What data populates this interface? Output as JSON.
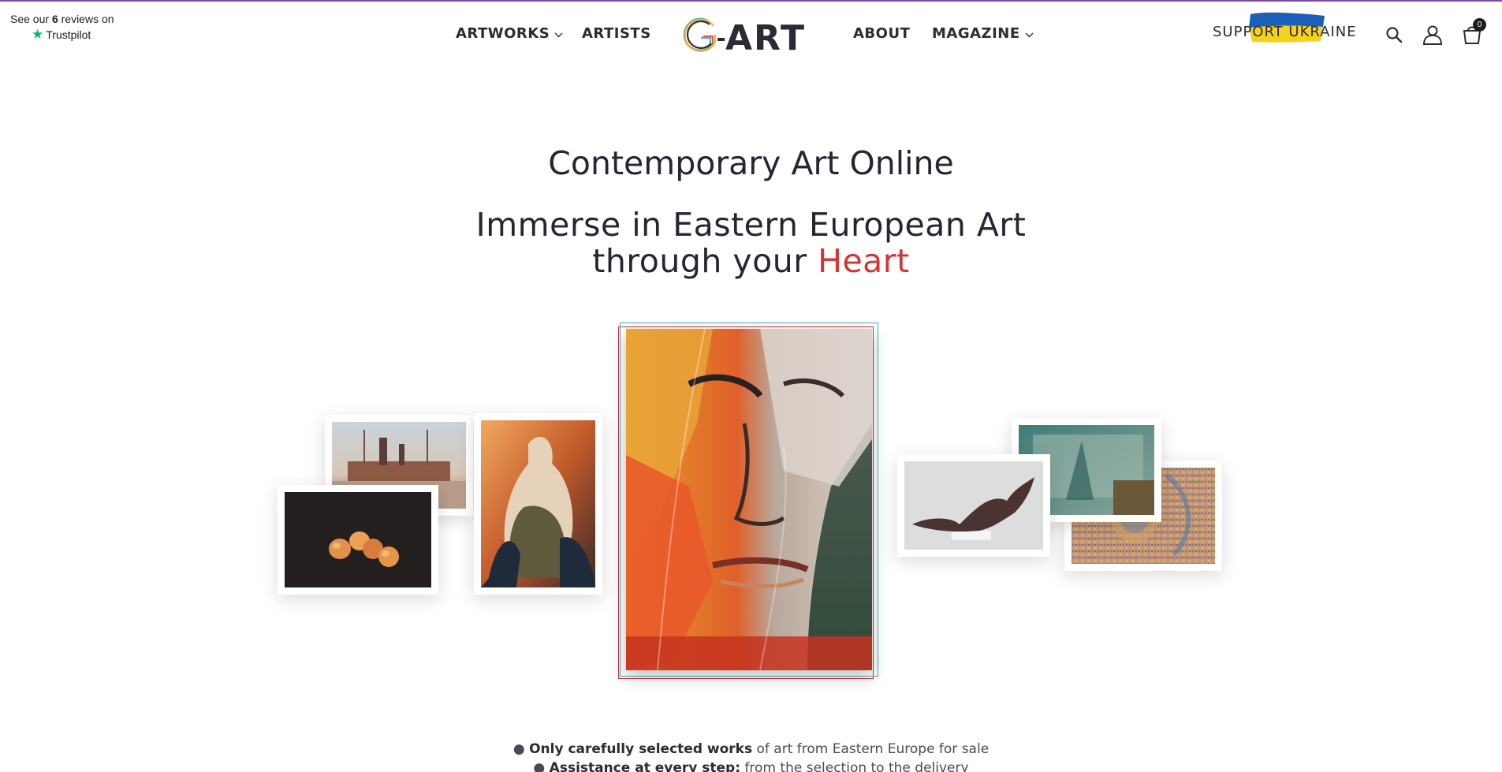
{
  "header": {
    "trustpilot": {
      "prefix": "See our",
      "count": "6",
      "suffix": "reviews on",
      "brand": "Trustpilot",
      "star_color": "#00b67a"
    },
    "nav_left": [
      {
        "label": "ARTWORKS",
        "has_dropdown": true
      },
      {
        "label": "ARTISTS",
        "has_dropdown": false
      }
    ],
    "logo_text": "G·ART",
    "nav_right": [
      {
        "label": "ABOUT",
        "has_dropdown": false
      },
      {
        "label": "MAGAZINE",
        "has_dropdown": true
      }
    ],
    "support_label": "SUPPORT UKRAINE",
    "cart_count": "0",
    "icons": [
      "search-icon",
      "user-icon",
      "cart-icon"
    ]
  },
  "hero": {
    "title": "Contemporary Art Online",
    "subtitle_line1": "Immerse in Eastern European Art",
    "subtitle_line2_prefix": "through your",
    "subtitle_accent": "Heart",
    "accent_color": "#d33532"
  },
  "artworks": [
    {
      "name": "ship-painting"
    },
    {
      "name": "peaches-painting"
    },
    {
      "name": "vase-painting"
    },
    {
      "name": "face-portrait-painting"
    },
    {
      "name": "bronze-sculpture"
    },
    {
      "name": "teal-abstract-painting"
    },
    {
      "name": "mosaic-painting"
    }
  ],
  "bullets": [
    {
      "bold": "Only carefully selected works",
      "rest": "of art from Eastern Europe for sale"
    },
    {
      "bold": "Assistance at every step:",
      "rest": "from the selection to the delivery"
    }
  ]
}
